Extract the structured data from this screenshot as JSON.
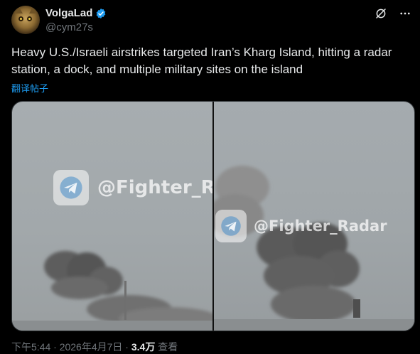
{
  "author": {
    "display_name": "VolgaLad",
    "handle": "@cym27s"
  },
  "post": {
    "text": "Heavy U.S./Israeli airstrikes targeted Iran’s Kharg Island, hitting a radar station, a dock, and multiple military sites on the island",
    "translate_label": "翻译帖子"
  },
  "media": {
    "watermark_text_left": "@Fighter_R",
    "watermark_text_right": "@Fighter_Radar",
    "watermark_icon": "telegram-icon"
  },
  "meta": {
    "time": "下午5:44",
    "sep1": " · ",
    "date": "2026年4月7日",
    "sep2": " · ",
    "views": "3.4万",
    "views_label": " 查看"
  },
  "icons": [
    "verified-badge-icon",
    "grok-icon",
    "more-icon",
    "telegram-icon"
  ],
  "colors": {
    "background": "#000000",
    "text": "#e7e9ea",
    "secondary_text": "#71767b",
    "accent": "#1d9bf0"
  }
}
